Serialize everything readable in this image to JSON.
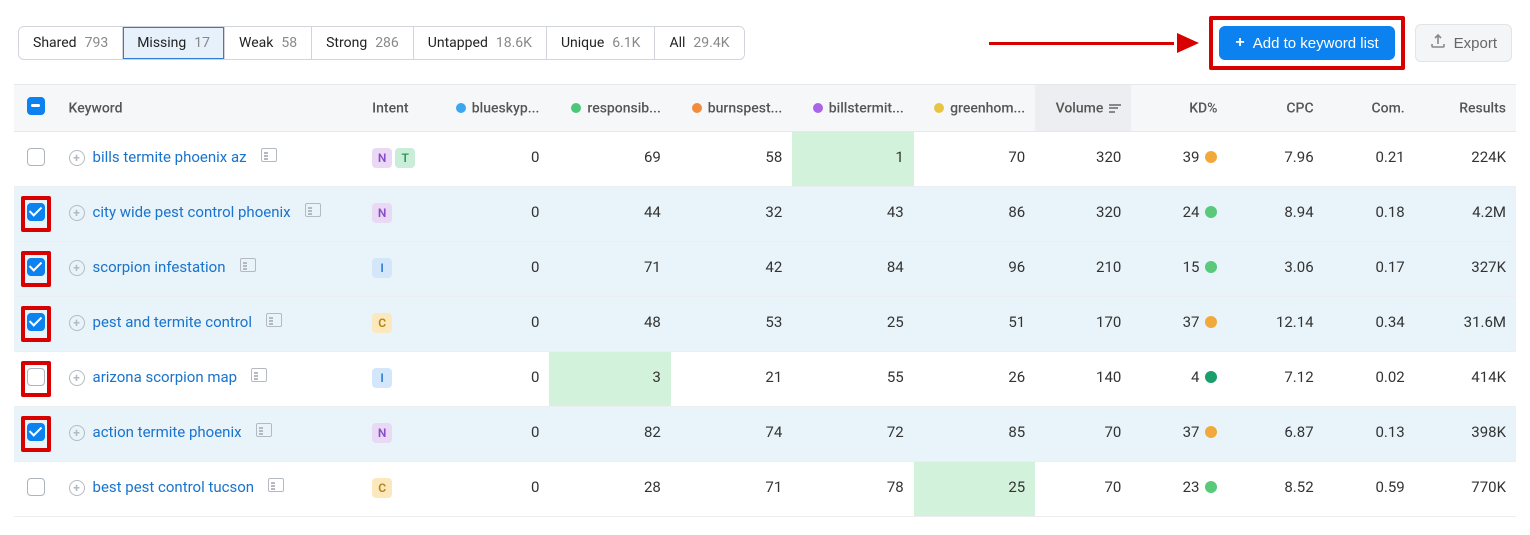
{
  "tabs": [
    {
      "label": "Shared",
      "count": "793",
      "active": false
    },
    {
      "label": "Missing",
      "count": "17",
      "active": true
    },
    {
      "label": "Weak",
      "count": "58",
      "active": false
    },
    {
      "label": "Strong",
      "count": "286",
      "active": false
    },
    {
      "label": "Untapped",
      "count": "18.6K",
      "active": false
    },
    {
      "label": "Unique",
      "count": "6.1K",
      "active": false
    },
    {
      "label": "All",
      "count": "29.4K",
      "active": false
    }
  ],
  "actions": {
    "add_label": "Add to keyword list",
    "export_label": "Export"
  },
  "columns": {
    "keyword": "Keyword",
    "intent": "Intent",
    "comp0": "blueskyp...",
    "comp1": "responsib...",
    "comp2": "burnspest...",
    "comp3": "billstermit...",
    "comp4": "greenhom...",
    "volume": "Volume",
    "kd": "KD%",
    "cpc": "CPC",
    "com": "Com.",
    "results": "Results"
  },
  "rows": [
    {
      "checked": false,
      "framed": false,
      "keyword": "bills termite phoenix az",
      "intent": [
        "N",
        "T"
      ],
      "c0": "0",
      "c1": "69",
      "c2": "58",
      "c3": "1",
      "c4": "70",
      "hl": [
        false,
        false,
        false,
        true,
        false
      ],
      "volume": "320",
      "kd": "39",
      "kd_color": "kd-orange",
      "cpc": "7.96",
      "com": "0.21",
      "results": "224K"
    },
    {
      "checked": true,
      "framed": true,
      "keyword": "city wide pest control phoenix",
      "intent": [
        "N"
      ],
      "c0": "0",
      "c1": "44",
      "c2": "32",
      "c3": "43",
      "c4": "86",
      "hl": [
        false,
        false,
        true,
        false,
        false
      ],
      "volume": "320",
      "kd": "24",
      "kd_color": "kd-green",
      "cpc": "8.94",
      "com": "0.18",
      "results": "4.2M"
    },
    {
      "checked": true,
      "framed": true,
      "keyword": "scorpion infestation",
      "intent": [
        "I"
      ],
      "c0": "0",
      "c1": "71",
      "c2": "42",
      "c3": "84",
      "c4": "96",
      "hl": [
        false,
        false,
        true,
        false,
        false
      ],
      "volume": "210",
      "kd": "15",
      "kd_color": "kd-green",
      "cpc": "3.06",
      "com": "0.17",
      "results": "327K"
    },
    {
      "checked": true,
      "framed": true,
      "keyword": "pest and termite control",
      "intent": [
        "C"
      ],
      "c0": "0",
      "c1": "48",
      "c2": "53",
      "c3": "25",
      "c4": "51",
      "hl": [
        false,
        false,
        false,
        true,
        false
      ],
      "volume": "170",
      "kd": "37",
      "kd_color": "kd-orange",
      "cpc": "12.14",
      "com": "0.34",
      "results": "31.6M"
    },
    {
      "checked": false,
      "framed": true,
      "keyword": "arizona scorpion map",
      "intent": [
        "I"
      ],
      "c0": "0",
      "c1": "3",
      "c2": "21",
      "c3": "55",
      "c4": "26",
      "hl": [
        false,
        true,
        false,
        false,
        false
      ],
      "volume": "140",
      "kd": "4",
      "kd_color": "kd-darkgreen",
      "cpc": "7.12",
      "com": "0.02",
      "results": "414K"
    },
    {
      "checked": true,
      "framed": true,
      "keyword": "action termite phoenix",
      "intent": [
        "N"
      ],
      "c0": "0",
      "c1": "82",
      "c2": "74",
      "c3": "72",
      "c4": "85",
      "hl": [
        false,
        false,
        false,
        true,
        false
      ],
      "volume": "70",
      "kd": "37",
      "kd_color": "kd-orange",
      "cpc": "6.87",
      "com": "0.13",
      "results": "398K"
    },
    {
      "checked": false,
      "framed": false,
      "keyword": "best pest control tucson",
      "intent": [
        "C"
      ],
      "c0": "0",
      "c1": "28",
      "c2": "71",
      "c3": "78",
      "c4": "25",
      "hl": [
        false,
        false,
        false,
        false,
        true
      ],
      "volume": "70",
      "kd": "23",
      "kd_color": "kd-green",
      "cpc": "8.52",
      "com": "0.59",
      "results": "770K"
    }
  ]
}
